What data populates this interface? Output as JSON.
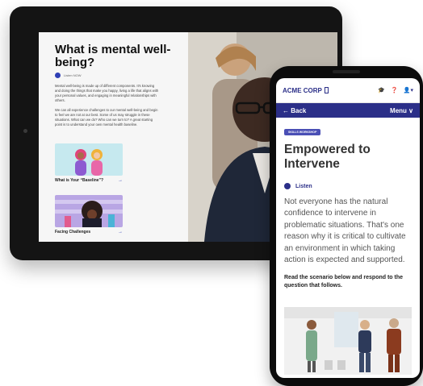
{
  "tablet": {
    "title": "What is mental well-being?",
    "listen_label": "Listen NOW",
    "paragraph_1": "Mental well-being is made up of different components. It's knowing and doing the things that make you happy, living a life that aligns with your personal values, and engaging in meaningful relationships with others.",
    "paragraph_2": "We can all experience challenges to our mental well-being and begin to feel we are not at our best. Some of us may struggle in these situations. What can we do? Who can we turn to? A great starting point is to understand your own mental health baseline.",
    "cards": [
      {
        "caption": "What is Your “Baseline”?",
        "arrow": "→"
      },
      {
        "caption": "Facing Challenges",
        "arrow": "→"
      }
    ]
  },
  "phone": {
    "brand": "ACME CORP",
    "header_icons": [
      "graduation-cap-icon",
      "help-icon",
      "account-icon"
    ],
    "nav": {
      "back_label": "← Back",
      "menu_label": "Menu ∨"
    },
    "badge": "SKILLS WORKSHOP",
    "title": "Empowered to Intervene",
    "listen_label": "Listen",
    "body": "Not everyone has the natural confidence to intervene in problematic situations. That's one reason why it is critical to cultivate an environment in which taking action is expected and supported.",
    "prompt": "Read the scenario below and respond to the question that follows."
  },
  "colors": {
    "brand": "#2b2f88",
    "accent": "#4a4fb5"
  }
}
